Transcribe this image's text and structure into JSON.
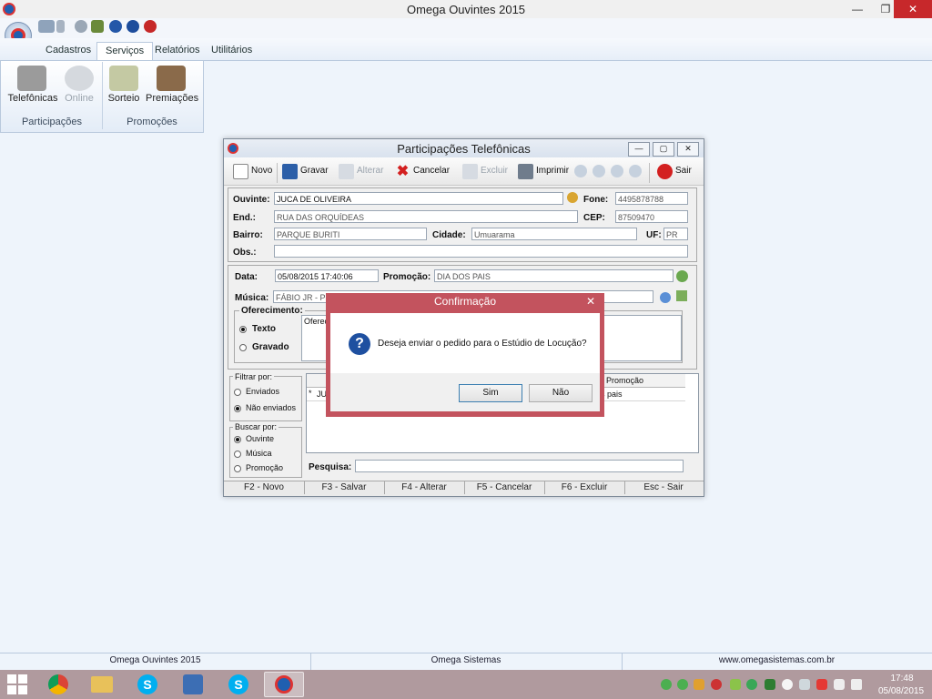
{
  "app": {
    "title": "Omega Ouvintes 2015"
  },
  "ribbon": {
    "tabs": [
      "Cadastros",
      "Serviços",
      "Relatórios",
      "Utilitários"
    ],
    "active_tab": "Serviços",
    "groups": [
      {
        "label": "Participações",
        "items": [
          "Telefônicas",
          "Online"
        ]
      },
      {
        "label": "Promoções",
        "items": [
          "Sorteio",
          "Premiações"
        ]
      }
    ]
  },
  "child": {
    "title": "Participações Telefônicas",
    "toolbar": {
      "novo": "Novo",
      "gravar": "Gravar",
      "alterar": "Alterar",
      "cancelar": "Cancelar",
      "excluir": "Excluir",
      "imprimir": "Imprimir",
      "sair": "Sair"
    },
    "form": {
      "ouvinte_label": "Ouvinte:",
      "ouvinte": "JUCA DE OLIVEIRA",
      "fone_label": "Fone:",
      "fone": "4495878788",
      "end_label": "End.:",
      "end": "RUA DAS ORQUÍDEAS",
      "cep_label": "CEP:",
      "cep": "87509470",
      "bairro_label": "Bairro:",
      "bairro": "PARQUE BURITI",
      "cidade_label": "Cidade:",
      "cidade": "Umuarama",
      "uf_label": "UF:",
      "uf": "PR",
      "obs_label": "Obs.:",
      "obs": "",
      "data_label": "Data:",
      "data": "05/08/2015 17:40:06",
      "promocao_label": "Promoção:",
      "promocao": "DIA DOS PAIS",
      "musica_label": "Música:",
      "musica": "FÁBIO JR - P",
      "oferecimento_label": "Oferecimento:",
      "texto_label": "Texto",
      "gravado_label": "Gravado",
      "oferecimento_text": "Oferec"
    },
    "filtrar": {
      "label": "Filtrar por:",
      "options": [
        "Enviados",
        "Não enviados"
      ],
      "selected": "Não enviados"
    },
    "buscar": {
      "label": "Buscar por:",
      "options": [
        "Ouvinte",
        "Música",
        "Promoção"
      ],
      "selected": "Ouvinte"
    },
    "grid": {
      "col_promocao": "Promoção",
      "row_marker": "*",
      "row_first": "JU",
      "row_promocao": "s pais"
    },
    "pesquisa_label": "Pesquisa:",
    "fkeys": [
      "F2 - Novo",
      "F3 - Salvar",
      "F4 - Alterar",
      "F5 - Cancelar",
      "F6 - Excluir",
      "Esc - Sair"
    ]
  },
  "dialog": {
    "title": "Confirmação",
    "message": "Deseja enviar o pedido para o Estúdio de Locução?",
    "yes": "Sim",
    "no": "Não"
  },
  "statusbar": [
    "Omega Ouvintes 2015",
    "Omega Sistemas",
    "www.omegasistemas.com.br"
  ],
  "clock": {
    "time": "17:48",
    "date": "05/08/2015"
  }
}
